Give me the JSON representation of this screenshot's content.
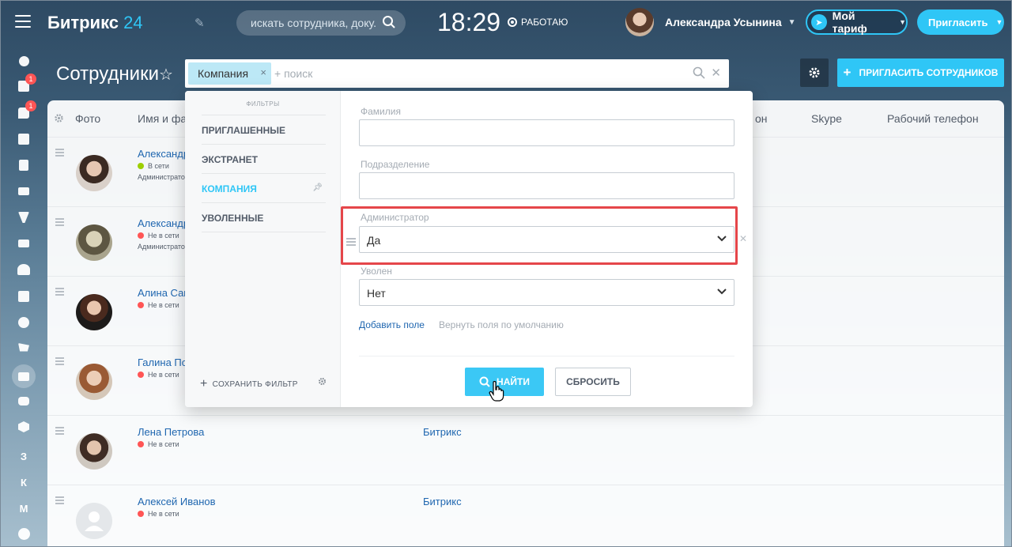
{
  "topbar": {
    "logo_text": "Битрикс",
    "logo_num": "24",
    "search_placeholder": "искать сотрудника, доку...",
    "clock": "18:29",
    "work_status": "РАБОТАЮ",
    "user_name": "Александра Усынина",
    "tariff_label": "Мой тариф",
    "invite_label": "Пригласить"
  },
  "sidebar": {
    "badges": [
      "1",
      "1"
    ],
    "letters": [
      "З",
      "К",
      "М"
    ]
  },
  "page": {
    "title": "Сотрудники",
    "filter_chip": "Компания",
    "search_placeholder": "+ поиск",
    "invite_employees": "ПРИГЛАСИТЬ СОТРУДНИКОВ"
  },
  "grid": {
    "columns": [
      "Фото",
      "Имя и фам",
      "он",
      "Skype",
      "Рабочий телефон"
    ],
    "rows": [
      {
        "name": "Александра",
        "status": "В сети",
        "role": "Администратор",
        "dept": "",
        "status_color": "#9dcf00"
      },
      {
        "name": "Александр",
        "status": "Не в сети",
        "role": "Администратор",
        "dept": "",
        "status_color": "#f55"
      },
      {
        "name": "Алина Сави",
        "status": "Не в сети",
        "role": "",
        "dept": "",
        "status_color": "#f55"
      },
      {
        "name": "Галина Поп",
        "status": "Не в сети",
        "role": "",
        "dept": "",
        "status_color": "#f55"
      },
      {
        "name": "Лена Петрова",
        "status": "Не в сети",
        "role": "",
        "dept": "Битрикс",
        "status_color": "#f55"
      },
      {
        "name": "Алексей Иванов",
        "status": "Не в сети",
        "role": "",
        "dept": "Битрикс",
        "status_color": "#f55"
      }
    ]
  },
  "filter": {
    "header": "ФИЛЬТРЫ",
    "presets": [
      "ПРИГЛАШЕННЫЕ",
      "ЭКСТРАНЕТ",
      "КОМПАНИЯ",
      "УВОЛЕННЫЕ"
    ],
    "save_filter": "СОХРАНИТЬ ФИЛЬТР",
    "fields": {
      "last_name_label": "Фамилия",
      "department_label": "Подразделение",
      "admin_label": "Администратор",
      "admin_value": "Да",
      "fired_label": "Уволен",
      "fired_value": "Нет"
    },
    "add_field": "Добавить поле",
    "restore_defaults": "Вернуть поля по умолчанию",
    "find_button": "НАЙТИ",
    "reset_button": "СБРОСИТЬ"
  },
  "colors": {
    "accent": "#2fc6f6",
    "link": "#2067b0",
    "highlight": "#e5464a",
    "online": "#9dcf00",
    "offline": "#ff5555"
  }
}
